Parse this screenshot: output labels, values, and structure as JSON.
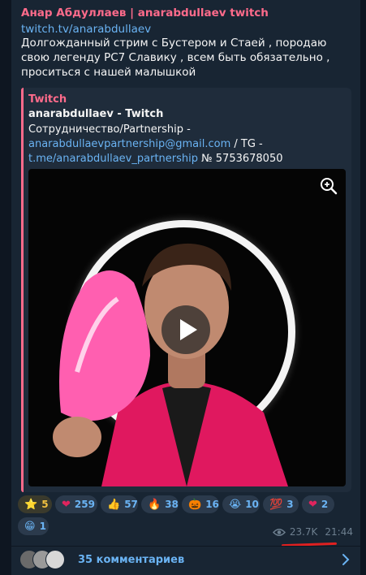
{
  "message": {
    "author": "Анар Абдуллаев | anarabdullaev twitch",
    "link": "twitch.tv/anarabdullaev",
    "text": "Долгожданный стрим с Бустером и Стаей , породаю свою легенду РС7 Славику , всем быть обязательно , проситься с нашей малышкой"
  },
  "preview": {
    "site": "Twitch",
    "title": "anarabdullaev - Twitch",
    "desc_line1": "Сотрудничество/Partnership -",
    "email": "anarabdullaevpartnership@gmail.com",
    "desc_mid": " / TG -",
    "tg_link": "t.me/anarabdullaev_partnership",
    "desc_end": " № 5753678050"
  },
  "reactions": [
    {
      "emoji": "⭐",
      "count": "5",
      "icon": "star-icon"
    },
    {
      "emoji": "❤",
      "count": "259",
      "icon": "heart-icon"
    },
    {
      "emoji": "👍",
      "count": "57",
      "icon": "thumbs-up-icon"
    },
    {
      "emoji": "🔥",
      "count": "38",
      "icon": "fire-icon"
    },
    {
      "emoji": "🎃",
      "count": "16",
      "icon": "pumpkin-icon"
    },
    {
      "emoji": "😭",
      "count": "10",
      "icon": "crying-face-icon"
    },
    {
      "emoji": "💯",
      "count": "3",
      "icon": "hundred-icon"
    },
    {
      "emoji": "❤",
      "count": "2",
      "icon": "heart-on-fire-icon"
    },
    {
      "emoji": "😁",
      "count": "1",
      "icon": "grin-face-icon"
    }
  ],
  "meta": {
    "views": "23.7K",
    "time": "21:44"
  },
  "comments": {
    "label": "35 комментариев"
  },
  "colors": {
    "accent": "#ff6b8b",
    "link": "#6ab3f3",
    "bubble": "#182533",
    "background": "#0e1621",
    "underline": "#e02020"
  }
}
